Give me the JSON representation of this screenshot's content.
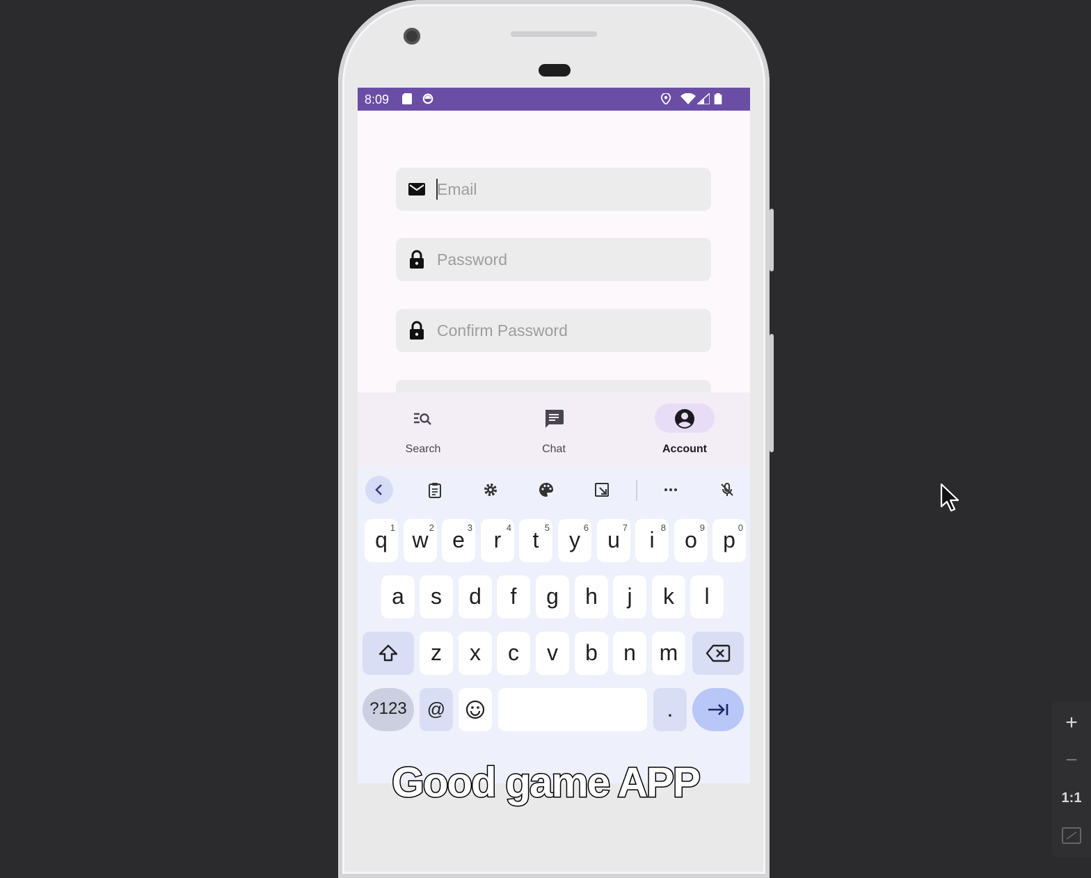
{
  "status_bar": {
    "time": "8:09",
    "background": "#6a4ea5"
  },
  "form": {
    "email_placeholder": "Email",
    "password_placeholder": "Password",
    "confirm_password_placeholder": "Confirm Password"
  },
  "bottom_nav": {
    "items": [
      {
        "label": "Search",
        "icon": "search-list-icon",
        "active": false
      },
      {
        "label": "Chat",
        "icon": "chat-icon",
        "active": false
      },
      {
        "label": "Account",
        "icon": "account-circle-icon",
        "active": true
      }
    ]
  },
  "keyboard": {
    "toolbar_icons": [
      "back-icon",
      "clipboard-icon",
      "settings-icon",
      "palette-icon",
      "resize-icon",
      "more-icon",
      "mic-off-icon"
    ],
    "row1": [
      {
        "k": "q",
        "h": "1"
      },
      {
        "k": "w",
        "h": "2"
      },
      {
        "k": "e",
        "h": "3"
      },
      {
        "k": "r",
        "h": "4"
      },
      {
        "k": "t",
        "h": "5"
      },
      {
        "k": "y",
        "h": "6"
      },
      {
        "k": "u",
        "h": "7"
      },
      {
        "k": "i",
        "h": "8"
      },
      {
        "k": "o",
        "h": "9"
      },
      {
        "k": "p",
        "h": "0"
      }
    ],
    "row2": [
      "a",
      "s",
      "d",
      "f",
      "g",
      "h",
      "j",
      "k",
      "l"
    ],
    "row3": [
      "z",
      "x",
      "c",
      "v",
      "b",
      "n",
      "m"
    ],
    "symbols_label": "?123",
    "at_label": "@",
    "period_label": "."
  },
  "caption": "Good game APP",
  "emulator_controls": {
    "zoom_in": "+",
    "zoom_out": "−",
    "actual_size": "1:1"
  }
}
